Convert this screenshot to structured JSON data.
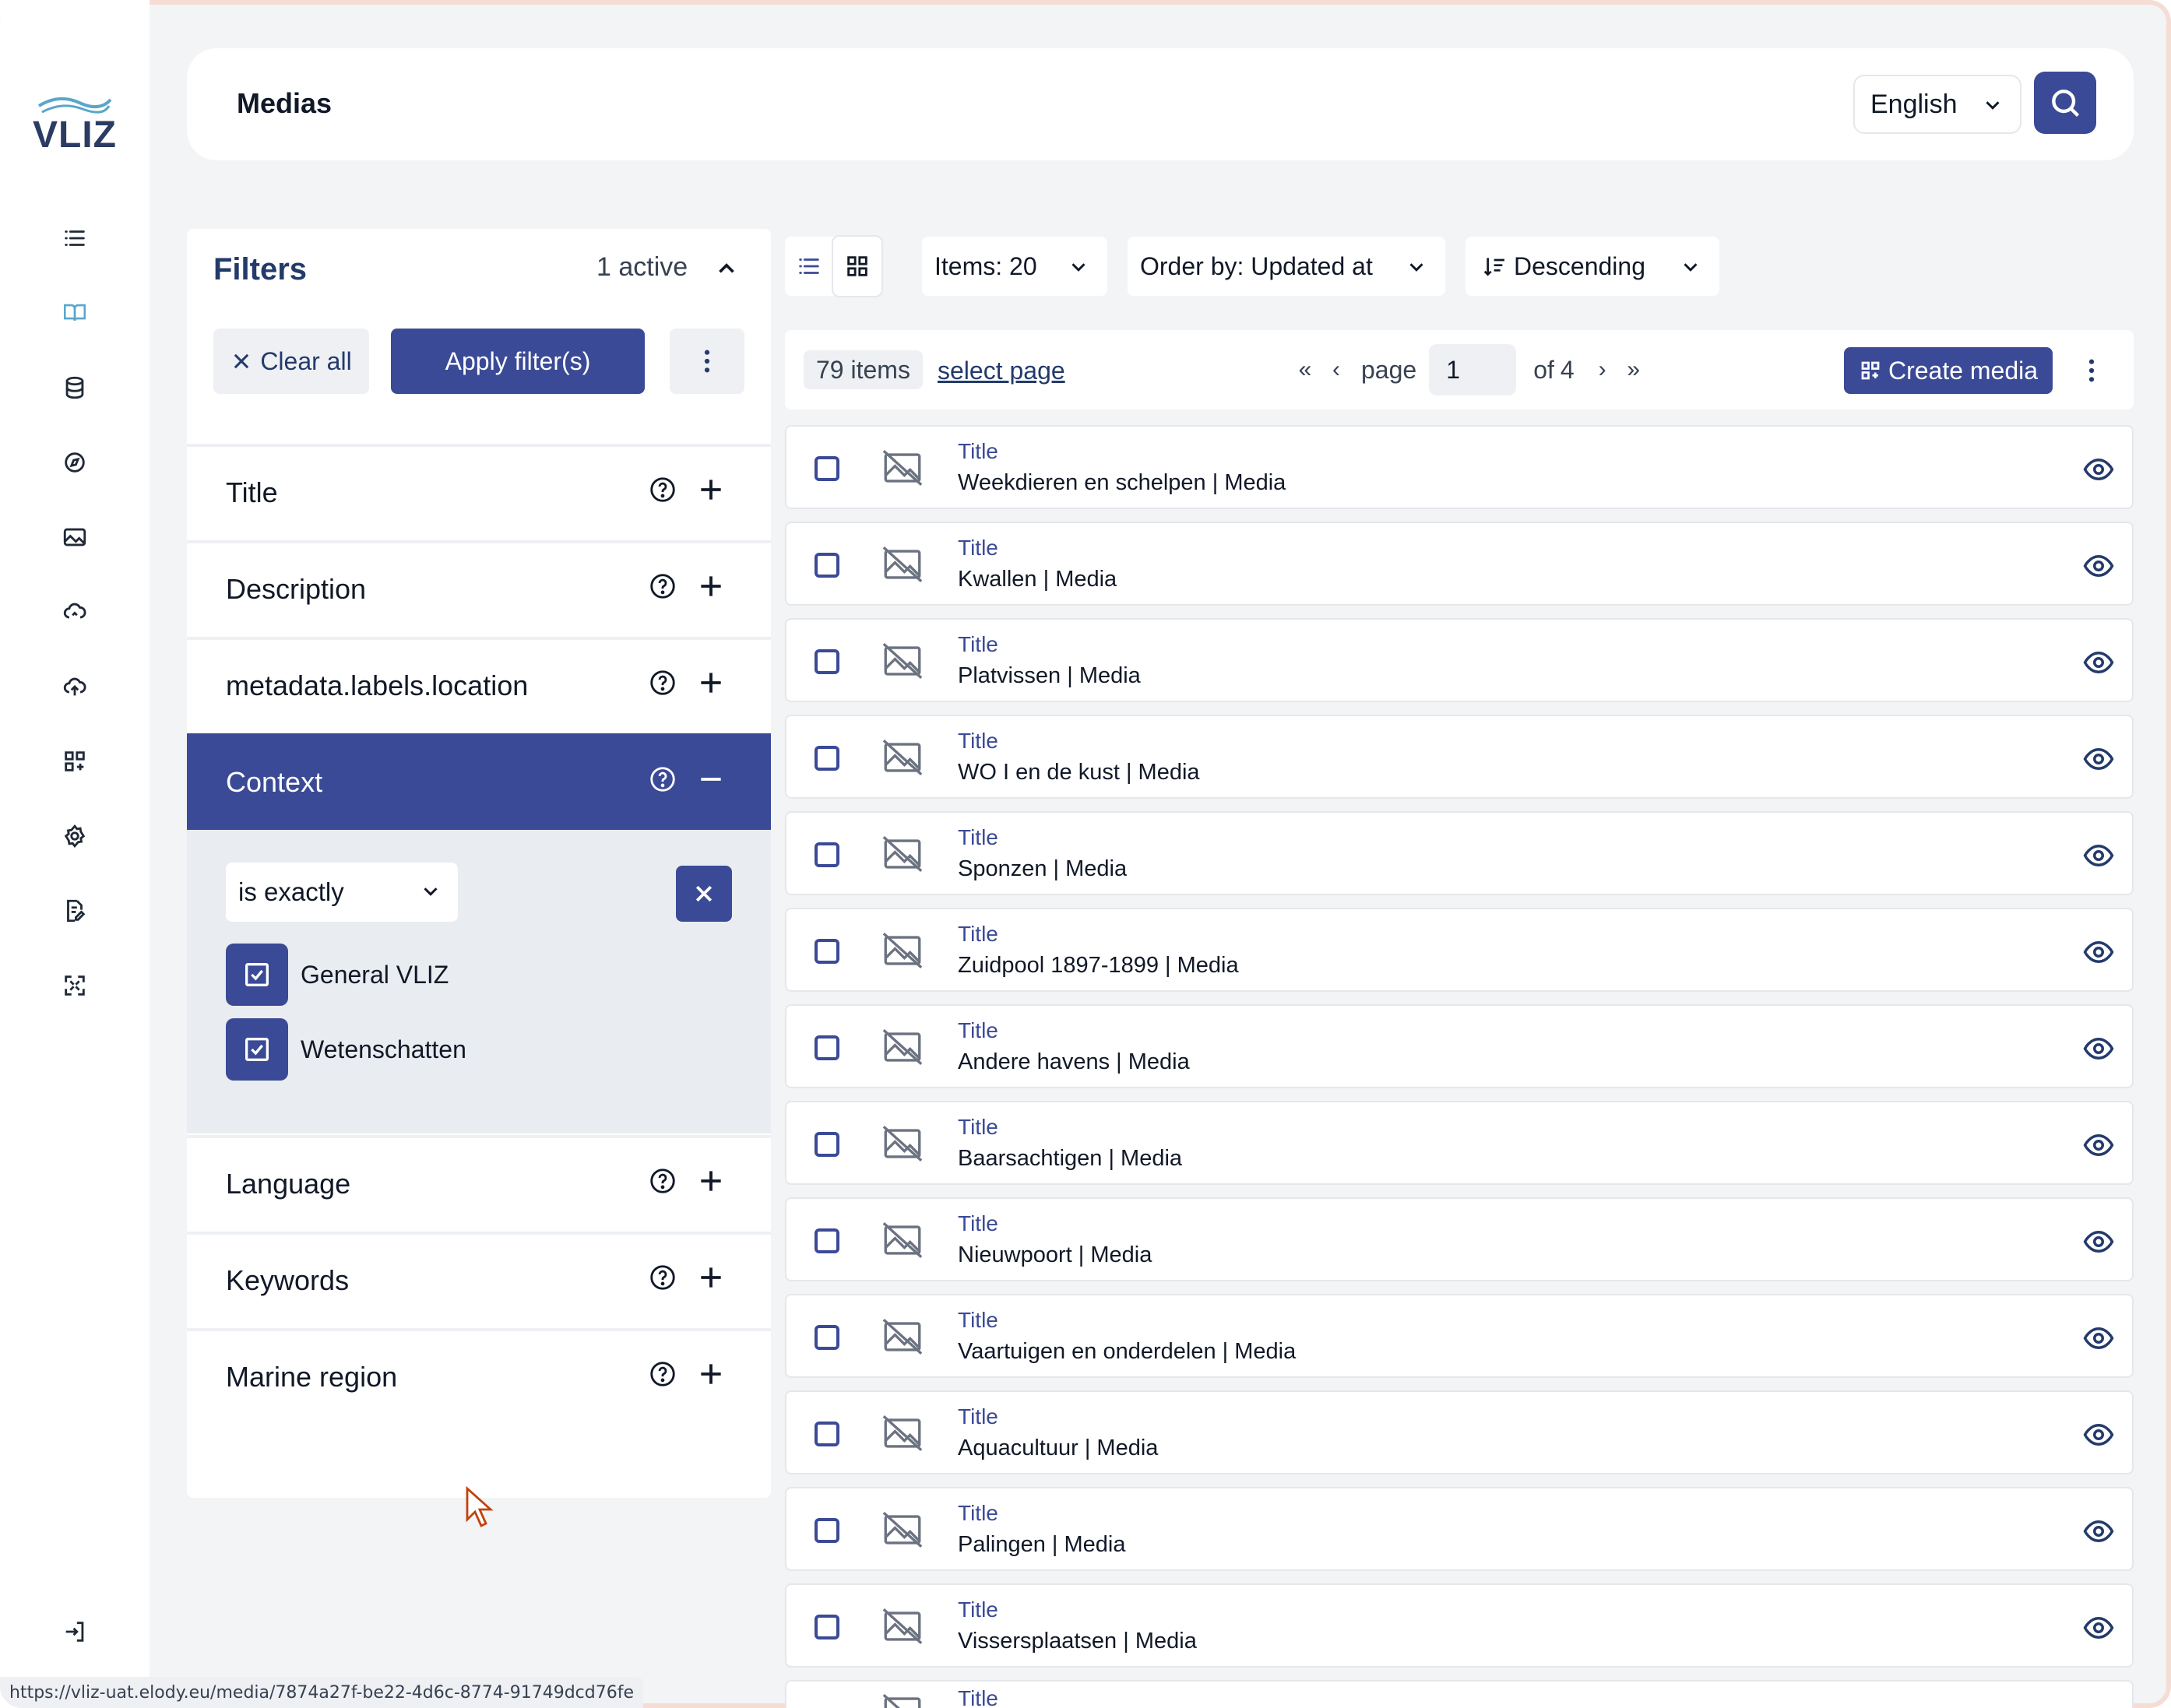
{
  "brand": {
    "logo_text": "VLIZ"
  },
  "colors": {
    "primary": "#3b4a96",
    "heading": "#233a6b",
    "background": "#f2f4f6",
    "panel": "#ffffff"
  },
  "sidebar": {
    "items": [
      {
        "icon": "list-icon"
      },
      {
        "icon": "book-icon"
      },
      {
        "icon": "database-icon"
      },
      {
        "icon": "compass-icon"
      },
      {
        "icon": "image-icon"
      },
      {
        "icon": "cloud-icon"
      },
      {
        "icon": "cloud-upload-icon"
      },
      {
        "icon": "grid-add-icon"
      },
      {
        "icon": "gear-icon"
      },
      {
        "icon": "document-edit-icon"
      },
      {
        "icon": "expand-arrows-icon"
      }
    ],
    "bottom_icon": "logout-icon"
  },
  "header": {
    "title": "Medias",
    "language": "English",
    "search_icon": "search-icon"
  },
  "filters": {
    "title": "Filters",
    "active_count": "1 active",
    "clear_label": "Clear all",
    "apply_label": "Apply filter(s)",
    "rows": [
      {
        "label": "Title"
      },
      {
        "label": "Description"
      },
      {
        "label": "metadata.labels.location"
      },
      {
        "label": "Context"
      },
      {
        "label": "Language"
      },
      {
        "label": "Keywords"
      },
      {
        "label": "Marine region"
      }
    ],
    "context": {
      "operator": "is exactly",
      "options": [
        {
          "label": "General VLIZ",
          "checked": true
        },
        {
          "label": "Wetenschatten",
          "checked": true
        }
      ]
    }
  },
  "toolbar": {
    "items": "Items: 20",
    "order": "Order by: Updated at",
    "direction": "Descending"
  },
  "results": {
    "count": "79 items",
    "select_page": "select page",
    "page_word": "page",
    "page": "1",
    "of_word": "of",
    "total_pages": "4",
    "create_label": "Create media"
  },
  "list": {
    "field_label": "Title",
    "items": [
      "Weekdieren en schelpen | Media",
      "Kwallen | Media",
      "Platvissen | Media",
      "WO I en de kust | Media",
      "Sponzen | Media",
      "Zuidpool 1897-1899 | Media",
      "Andere havens | Media",
      "Baarsachtigen | Media",
      "Nieuwpoort | Media",
      "Vaartuigen en onderdelen | Media",
      "Aquacultuur | Media",
      "Palingen | Media",
      "Vissersplaatsen | Media"
    ],
    "partial_label": "Title"
  },
  "status_url": "https://vliz-uat.elody.eu/media/7874a27f-be22-4d6c-8774-91749dcd76fe"
}
